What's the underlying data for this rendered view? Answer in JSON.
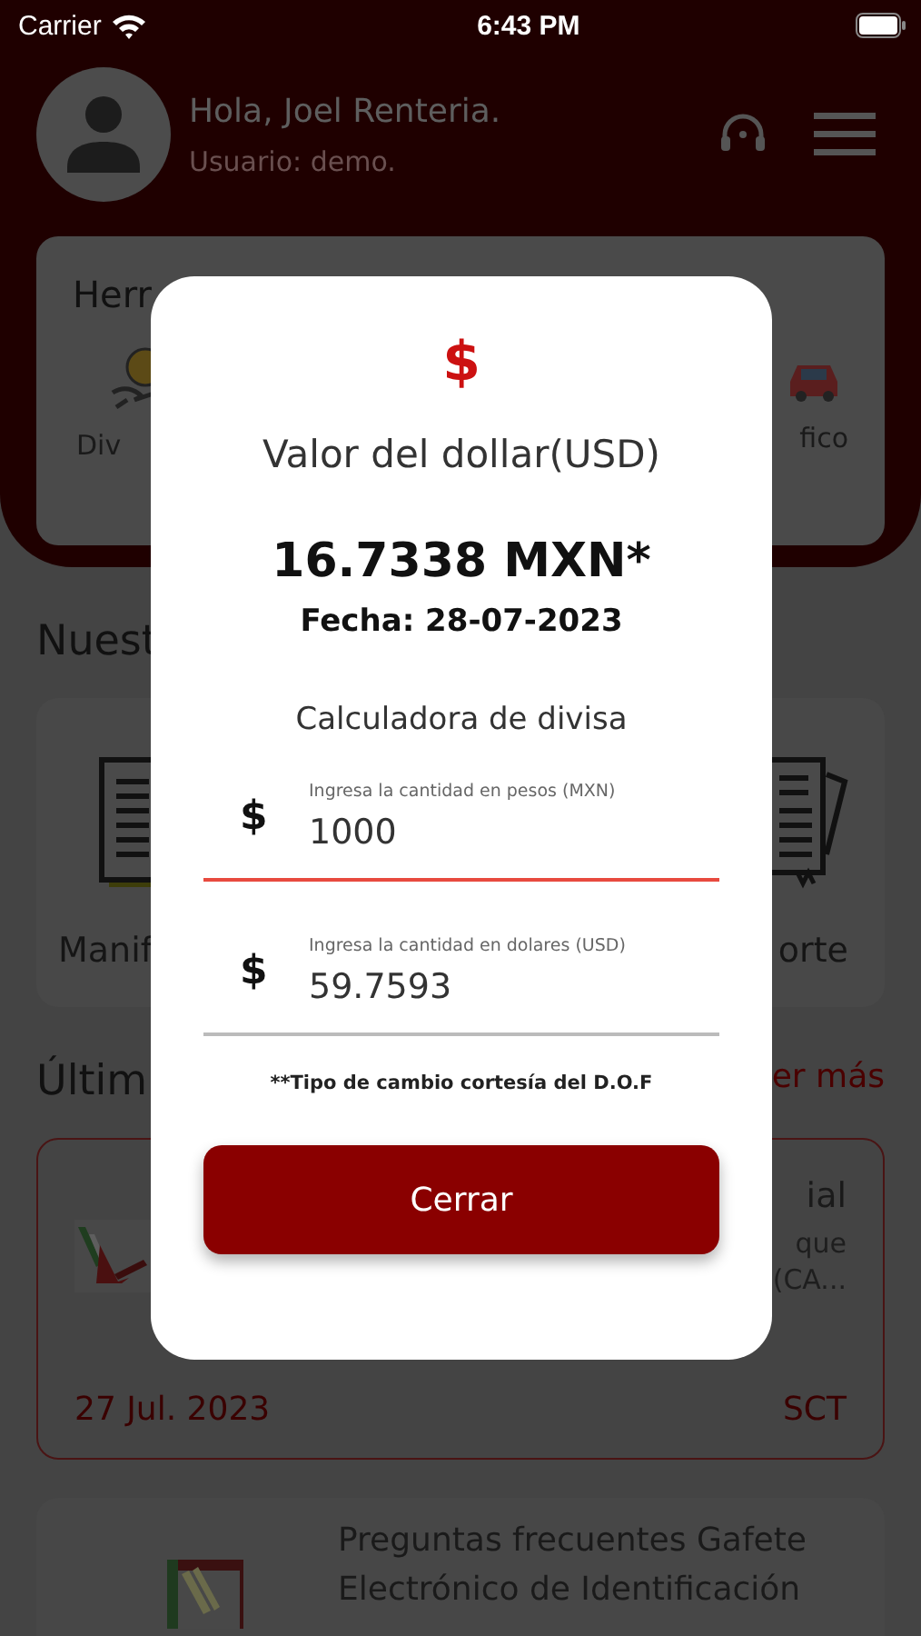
{
  "status_bar": {
    "carrier": "Carrier",
    "time": "6:43 PM"
  },
  "header": {
    "greeting": "Hola, Joel Renteria.",
    "user": "Usuario: demo."
  },
  "tools": {
    "title": "Herr",
    "items": [
      {
        "label": "Div",
        "kind": "coin"
      },
      {
        "label": "fico",
        "kind": "car"
      }
    ]
  },
  "services": {
    "title": "Nuest",
    "items": [
      {
        "label": "Manif",
        "kind": "document"
      },
      {
        "label": "orte",
        "kind": "report"
      }
    ]
  },
  "latest": {
    "title": "Últim",
    "link": "er más",
    "news": [
      {
        "title": "ial",
        "summary": [
          "que",
          "(CA..."
        ],
        "date": "27 Jul. 2023",
        "source": "SCT"
      },
      {
        "title": "Preguntas frecuentes Gafete Electrónico de Identificación"
      }
    ]
  },
  "modal": {
    "icon": "$",
    "title": "Valor del dollar(USD)",
    "rate": "16.7338 MXN*",
    "date": "Fecha: 28-07-2023",
    "subtitle": "Calculadora de divisa",
    "fields": [
      {
        "prefix": "$",
        "label": "Ingresa la cantidad en pesos (MXN)",
        "value": "1000",
        "focused": true
      },
      {
        "prefix": "$",
        "label": "Ingresa la cantidad en dolares (USD)",
        "value": "59.7593",
        "focused": false
      }
    ],
    "note": "**Tipo de cambio cortesía del D.O.F",
    "button": "Cerrar"
  }
}
